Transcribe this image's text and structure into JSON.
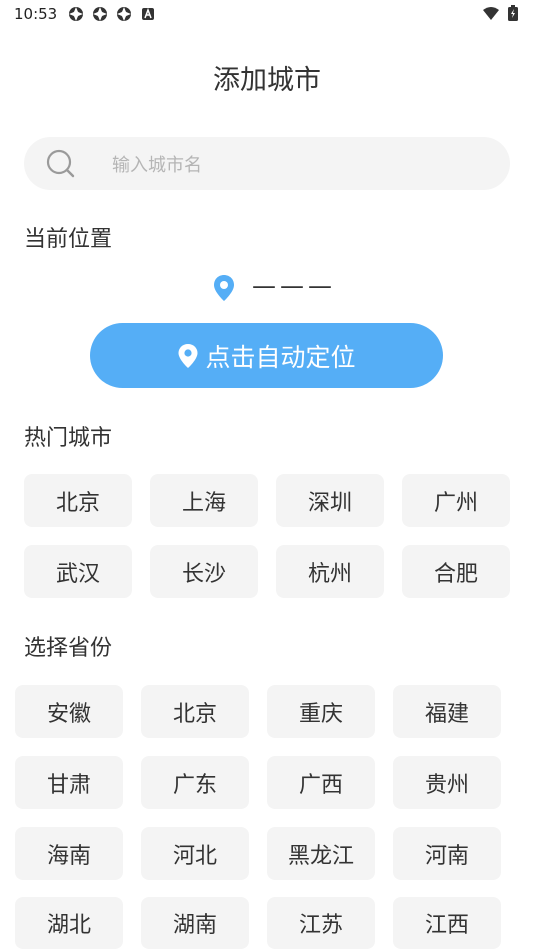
{
  "status_bar": {
    "time": "10:53",
    "icons": [
      "sync-icon",
      "sync-icon",
      "sync-icon",
      "a-icon"
    ],
    "right_icons": [
      "wifi-icon",
      "battery-icon"
    ]
  },
  "page_title": "添加城市",
  "search": {
    "placeholder": "输入城市名",
    "value": ""
  },
  "current_location": {
    "heading": "当前位置",
    "value": "———",
    "locate_button_label": "点击自动定位"
  },
  "hot_cities": {
    "heading": "热门城市",
    "items": [
      "北京",
      "上海",
      "深圳",
      "广州",
      "武汉",
      "长沙",
      "杭州",
      "合肥"
    ]
  },
  "provinces": {
    "heading": "选择省份",
    "items": [
      "安徽",
      "北京",
      "重庆",
      "福建",
      "甘肃",
      "广东",
      "广西",
      "贵州",
      "海南",
      "河北",
      "黑龙江",
      "河南",
      "湖北",
      "湖南",
      "江苏",
      "江西"
    ]
  },
  "colors": {
    "accent": "#55aef6",
    "chip_bg": "#f4f4f4",
    "text": "#333333",
    "placeholder": "#b5b5b5"
  }
}
